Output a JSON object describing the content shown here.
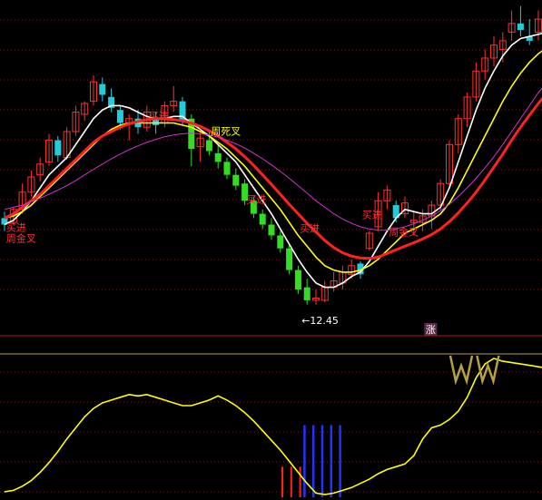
{
  "chart_data": [
    {
      "type": "candlestick",
      "price_label": "12.45",
      "annotations": [
        {
          "text": "买进",
          "x_index": 1,
          "price": 11.3,
          "color": "#ff3030"
        },
        {
          "text": "周金叉",
          "x_index": 1,
          "price": 11.05,
          "color": "#ff3030"
        },
        {
          "text": "买进",
          "x_index": 17,
          "price": 13.88,
          "color": "#ff3030"
        },
        {
          "text": "周死叉",
          "x_index": 24,
          "price": 13.53,
          "color": "#ffff00"
        },
        {
          "text": "买进",
          "x_index": 28,
          "price": 11.95,
          "color": "#ff3030"
        },
        {
          "text": "买进",
          "x_index": 34,
          "price": 11.28,
          "color": "#ff3030"
        },
        {
          "text": "买进",
          "x_index": 41,
          "price": 11.6,
          "color": "#ff3030"
        },
        {
          "text": "周金叉",
          "x_index": 44,
          "price": 11.2,
          "color": "#ff3030"
        }
      ],
      "badge": {
        "text": "涨",
        "x_index": 48
      },
      "candles": [
        [
          11.6,
          11.75,
          11.3,
          11.45
        ],
        [
          11.5,
          11.85,
          11.45,
          11.8
        ],
        [
          11.8,
          12.4,
          11.7,
          12.2
        ],
        [
          12.2,
          12.7,
          12.1,
          12.55
        ],
        [
          12.6,
          13.0,
          12.45,
          12.85
        ],
        [
          12.9,
          13.55,
          12.8,
          13.4
        ],
        [
          13.4,
          13.5,
          12.9,
          13.05
        ],
        [
          13.0,
          13.7,
          12.95,
          13.6
        ],
        [
          13.6,
          14.2,
          13.5,
          14.05
        ],
        [
          14.0,
          14.3,
          13.85,
          14.25
        ],
        [
          14.3,
          14.9,
          14.2,
          14.75
        ],
        [
          14.7,
          14.85,
          14.3,
          14.45
        ],
        [
          14.4,
          14.6,
          14.05,
          14.15
        ],
        [
          14.1,
          14.2,
          13.65,
          13.8
        ],
        [
          13.8,
          14.0,
          13.4,
          13.9
        ],
        [
          13.9,
          14.1,
          13.55,
          13.7
        ],
        [
          13.7,
          14.2,
          13.6,
          14.05
        ],
        [
          13.9,
          14.05,
          13.55,
          13.75
        ],
        [
          13.8,
          14.3,
          13.7,
          14.2
        ],
        [
          14.2,
          14.65,
          14.05,
          14.3
        ],
        [
          14.3,
          14.4,
          13.75,
          13.85
        ],
        [
          13.9,
          14.0,
          12.8,
          13.2
        ],
        [
          13.25,
          13.6,
          12.9,
          13.45
        ],
        [
          13.4,
          13.6,
          13.05,
          13.15
        ],
        [
          13.1,
          13.3,
          12.75,
          12.9
        ],
        [
          12.9,
          13.0,
          12.5,
          12.6
        ],
        [
          12.6,
          12.75,
          12.25,
          12.35
        ],
        [
          12.4,
          12.5,
          11.9,
          12.0
        ],
        [
          12.0,
          12.1,
          11.6,
          11.7
        ],
        [
          11.7,
          11.8,
          11.35,
          11.45
        ],
        [
          11.45,
          11.6,
          11.1,
          11.2
        ],
        [
          11.2,
          11.3,
          10.8,
          10.9
        ],
        [
          10.9,
          11.0,
          10.3,
          10.4
        ],
        [
          10.4,
          10.5,
          9.85,
          9.95
        ],
        [
          10.0,
          10.2,
          9.6,
          9.7
        ],
        [
          9.7,
          9.95,
          9.6,
          9.75
        ],
        [
          9.7,
          10.15,
          9.65,
          10.0
        ],
        [
          10.0,
          10.35,
          9.9,
          10.15
        ],
        [
          10.1,
          10.5,
          9.95,
          10.35
        ],
        [
          10.3,
          10.65,
          10.2,
          10.5
        ],
        [
          10.55,
          10.6,
          10.2,
          10.3
        ],
        [
          10.9,
          11.3,
          10.85,
          11.25
        ],
        [
          11.4,
          12.2,
          11.3,
          12.0
        ],
        [
          12.0,
          12.35,
          11.8,
          12.25
        ],
        [
          11.9,
          12.0,
          11.5,
          11.6
        ],
        [
          11.7,
          12.1,
          11.6,
          11.95
        ],
        [
          11.5,
          11.75,
          11.2,
          11.55
        ],
        [
          11.5,
          11.8,
          11.3,
          11.65
        ],
        [
          11.65,
          12.0,
          11.35,
          11.9
        ],
        [
          11.9,
          12.5,
          11.8,
          12.4
        ],
        [
          12.4,
          13.4,
          12.3,
          13.3
        ],
        [
          13.3,
          14.0,
          13.1,
          13.9
        ],
        [
          13.9,
          14.5,
          13.7,
          14.4
        ],
        [
          14.4,
          15.2,
          14.3,
          15.0
        ],
        [
          15.0,
          15.5,
          14.8,
          15.3
        ],
        [
          15.3,
          15.8,
          15.1,
          15.6
        ],
        [
          15.5,
          15.9,
          15.2,
          15.7
        ],
        [
          15.9,
          16.4,
          15.7,
          16.1
        ],
        [
          16.1,
          16.5,
          15.8,
          15.95
        ],
        [
          15.8,
          16.2,
          15.6,
          15.7
        ],
        [
          15.9,
          16.4,
          15.7,
          16.2
        ],
        [
          16.2,
          16.3,
          15.7,
          15.8
        ]
      ],
      "ma_lines": [
        {
          "name": "white",
          "color": "#ffffff",
          "values": [
            11.45,
            11.55,
            11.75,
            12.0,
            12.3,
            12.6,
            12.8,
            13.0,
            13.3,
            13.6,
            13.9,
            14.1,
            14.2,
            14.2,
            14.15,
            14.05,
            13.95,
            13.9,
            13.9,
            13.95,
            13.95,
            13.8,
            13.65,
            13.5,
            13.3,
            13.1,
            12.9,
            12.6,
            12.3,
            12.0,
            11.7,
            11.35,
            11.0,
            10.65,
            10.35,
            10.1,
            10.0,
            10.0,
            10.1,
            10.25,
            10.35,
            10.6,
            10.95,
            11.3,
            11.6,
            11.8,
            11.75,
            11.7,
            11.7,
            11.85,
            12.3,
            12.9,
            13.5,
            14.1,
            14.6,
            15.0,
            15.35,
            15.6,
            15.75,
            15.8,
            15.85,
            15.9
          ]
        },
        {
          "name": "yellow",
          "color": "#ffff00",
          "values": [
            11.6,
            11.65,
            11.75,
            11.9,
            12.1,
            12.3,
            12.5,
            12.7,
            12.9,
            13.1,
            13.3,
            13.5,
            13.65,
            13.75,
            13.8,
            13.8,
            13.8,
            13.8,
            13.8,
            13.8,
            13.75,
            13.7,
            13.6,
            13.5,
            13.35,
            13.2,
            13.0,
            12.8,
            12.55,
            12.3,
            12.05,
            11.8,
            11.5,
            11.2,
            10.95,
            10.7,
            10.5,
            10.4,
            10.35,
            10.35,
            10.4,
            10.5,
            10.65,
            10.85,
            11.05,
            11.25,
            11.35,
            11.45,
            11.55,
            11.7,
            11.95,
            12.3,
            12.7,
            13.1,
            13.5,
            13.9,
            14.3,
            14.65,
            14.95,
            15.2,
            15.4,
            15.55
          ]
        },
        {
          "name": "red",
          "color": "#ff2020",
          "width": 3,
          "values": [
            11.6,
            11.7,
            11.85,
            12.0,
            12.15,
            12.35,
            12.55,
            12.75,
            12.95,
            13.15,
            13.35,
            13.5,
            13.6,
            13.7,
            13.78,
            13.83,
            13.88,
            13.9,
            13.9,
            13.88,
            13.85,
            13.8,
            13.72,
            13.62,
            13.5,
            13.35,
            13.2,
            13.02,
            12.82,
            12.6,
            12.38,
            12.15,
            11.92,
            11.7,
            11.48,
            11.28,
            11.08,
            10.92,
            10.8,
            10.72,
            10.68,
            10.67,
            10.7,
            10.78,
            10.87,
            10.95,
            11.03,
            11.12,
            11.22,
            11.35,
            11.52,
            11.72,
            11.95,
            12.2,
            12.48,
            12.78,
            13.08,
            13.4,
            13.7,
            13.98,
            14.25,
            14.5
          ]
        },
        {
          "name": "magenta",
          "color": "#cc33cc",
          "width": 1,
          "values": [
            11.8,
            11.85,
            11.9,
            11.98,
            12.06,
            12.15,
            12.25,
            12.35,
            12.47,
            12.6,
            12.73,
            12.85,
            12.97,
            13.08,
            13.18,
            13.27,
            13.35,
            13.42,
            13.48,
            13.52,
            13.55,
            13.56,
            13.55,
            13.52,
            13.47,
            13.4,
            13.32,
            13.22,
            13.1,
            12.97,
            12.83,
            12.68,
            12.52,
            12.35,
            12.18,
            12.0,
            11.85,
            11.7,
            11.58,
            11.48,
            11.4,
            11.35,
            11.32,
            11.32,
            11.35,
            11.4,
            11.47,
            11.55,
            11.65,
            11.77,
            11.92,
            12.1,
            12.3,
            12.52,
            12.76,
            13.02,
            13.3,
            13.6,
            13.9,
            14.2,
            14.5,
            14.75
          ]
        }
      ]
    },
    {
      "type": "line+bars",
      "line": [
        0.04,
        0.05,
        0.08,
        0.12,
        0.18,
        0.25,
        0.33,
        0.42,
        0.5,
        0.58,
        0.64,
        0.68,
        0.7,
        0.72,
        0.74,
        0.73,
        0.74,
        0.72,
        0.7,
        0.68,
        0.66,
        0.66,
        0.68,
        0.7,
        0.73,
        0.7,
        0.66,
        0.61,
        0.55,
        0.48,
        0.41,
        0.34,
        0.26,
        0.18,
        0.1,
        0.03,
        0.02,
        0.03,
        0.05,
        0.07,
        0.1,
        0.13,
        0.17,
        0.2,
        0.22,
        0.24,
        0.3,
        0.42,
        0.5,
        0.52,
        0.56,
        0.62,
        0.72,
        0.86,
        0.96,
        1.0,
        0.98,
        0.97,
        0.96,
        0.95,
        0.94,
        0.93
      ],
      "red_bars": [
        {
          "x_index": 35,
          "height": 0.22
        },
        {
          "x_index": 36,
          "height": 0.22
        },
        {
          "x_index": 37,
          "height": 0.22
        }
      ],
      "blue_bars": [
        {
          "x_index": 38,
          "height": 0.52
        },
        {
          "x_index": 39,
          "height": 0.52
        },
        {
          "x_index": 40,
          "height": 0.52
        },
        {
          "x_index": 41,
          "height": 0.52
        },
        {
          "x_index": 42,
          "height": 0.52
        }
      ],
      "w_markers": [
        {
          "x_index": 55
        },
        {
          "x_index": 58
        }
      ]
    }
  ]
}
